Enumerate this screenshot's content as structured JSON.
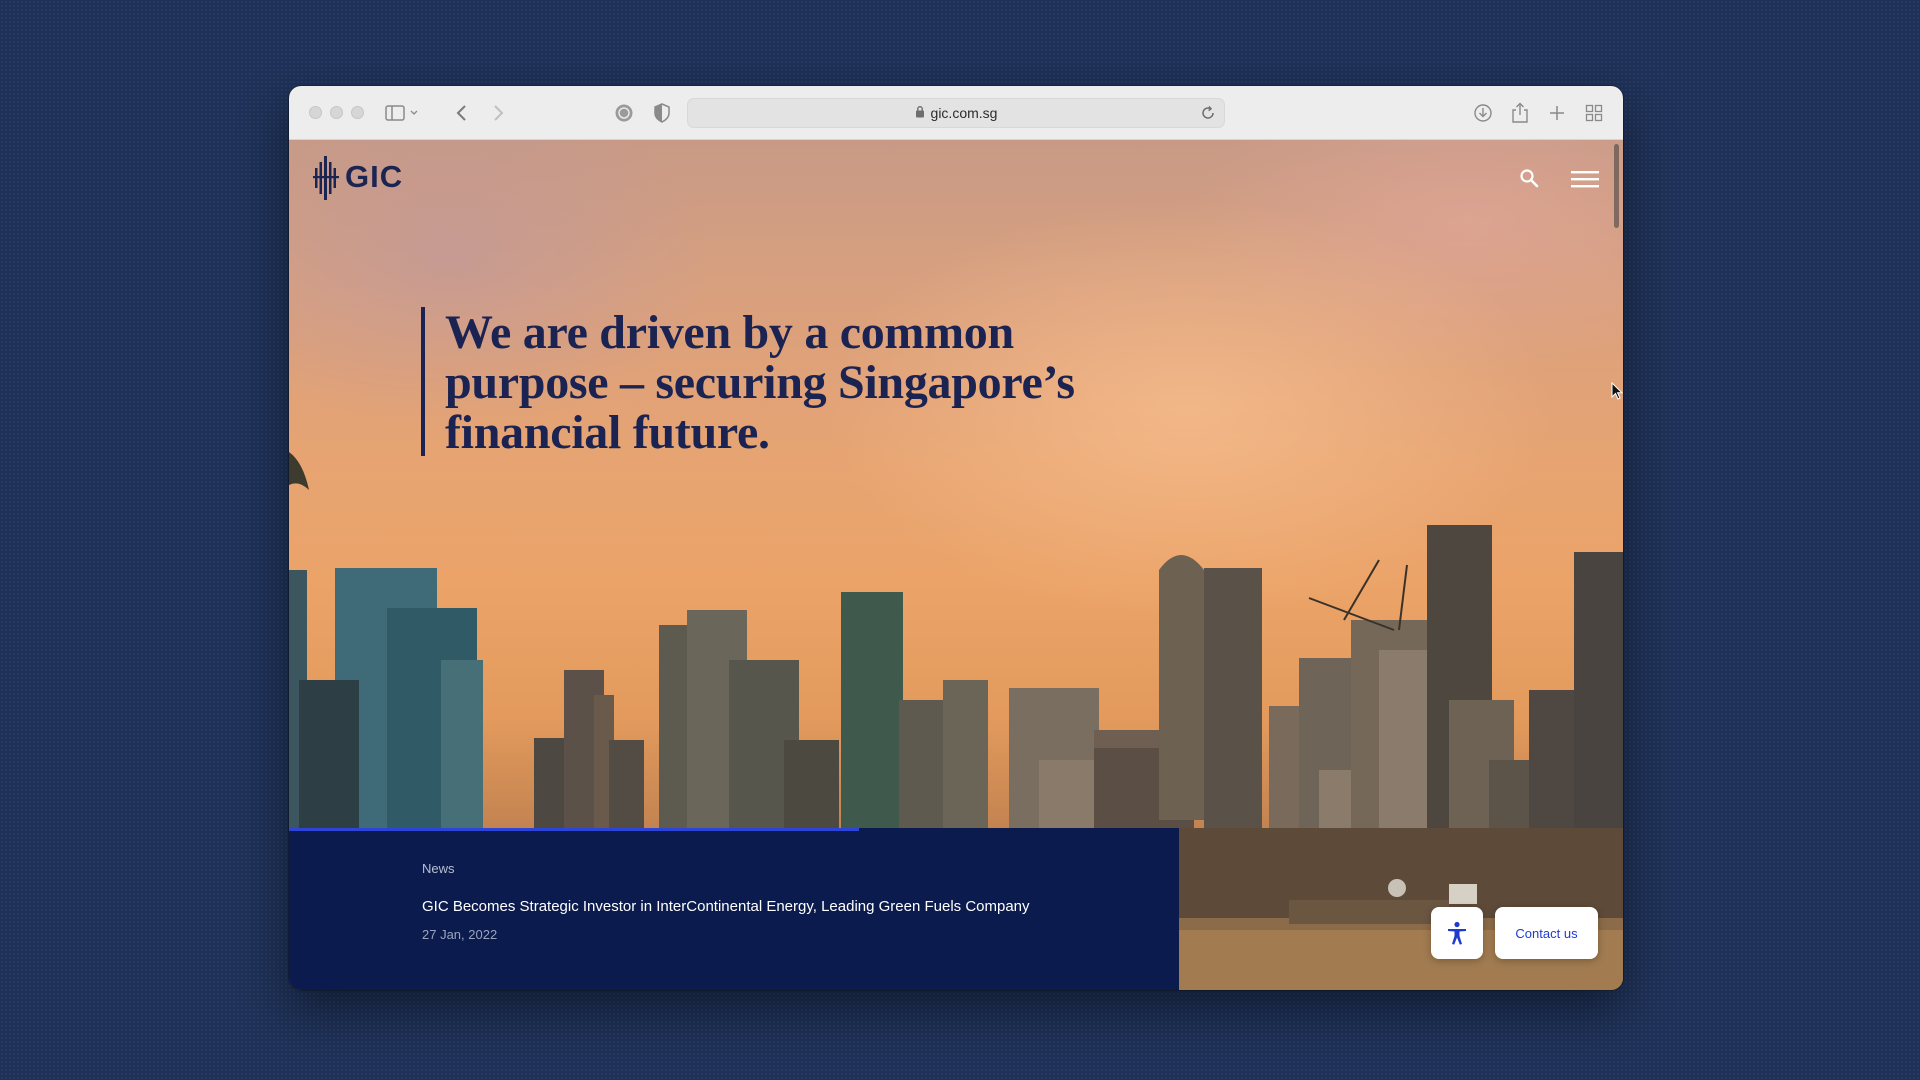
{
  "browser": {
    "url": "gic.com.sg",
    "icons": [
      "sidebar-icon",
      "back-icon",
      "forward-icon",
      "privacy-report-icon",
      "shield-icon",
      "lock-icon",
      "reload-icon",
      "download-icon",
      "share-icon",
      "new-tab-icon",
      "tab-overview-icon"
    ]
  },
  "site": {
    "logo_text": "GIC",
    "nav_icons": [
      "search-icon",
      "hamburger-menu-icon"
    ]
  },
  "hero": {
    "headline_line1": "We are driven by a common",
    "headline_line2": "purpose – securing Singapore’s",
    "headline_line3": "financial future."
  },
  "news": {
    "category": "News",
    "title": "GIC Becomes Strategic Investor in InterContinental Energy, Leading Green Fuels Company",
    "date": "27 Jan, 2022",
    "progress_fraction": 0.64
  },
  "actions": {
    "accessibility_icon": "accessibility-icon",
    "contact_label": "Contact us"
  },
  "colors": {
    "background": "#1e3158",
    "brand_navy": "#1b2352",
    "news_panel": "#0b1b4d",
    "progress_accent": "#2c44d8",
    "contact_text": "#1f3ad0"
  }
}
